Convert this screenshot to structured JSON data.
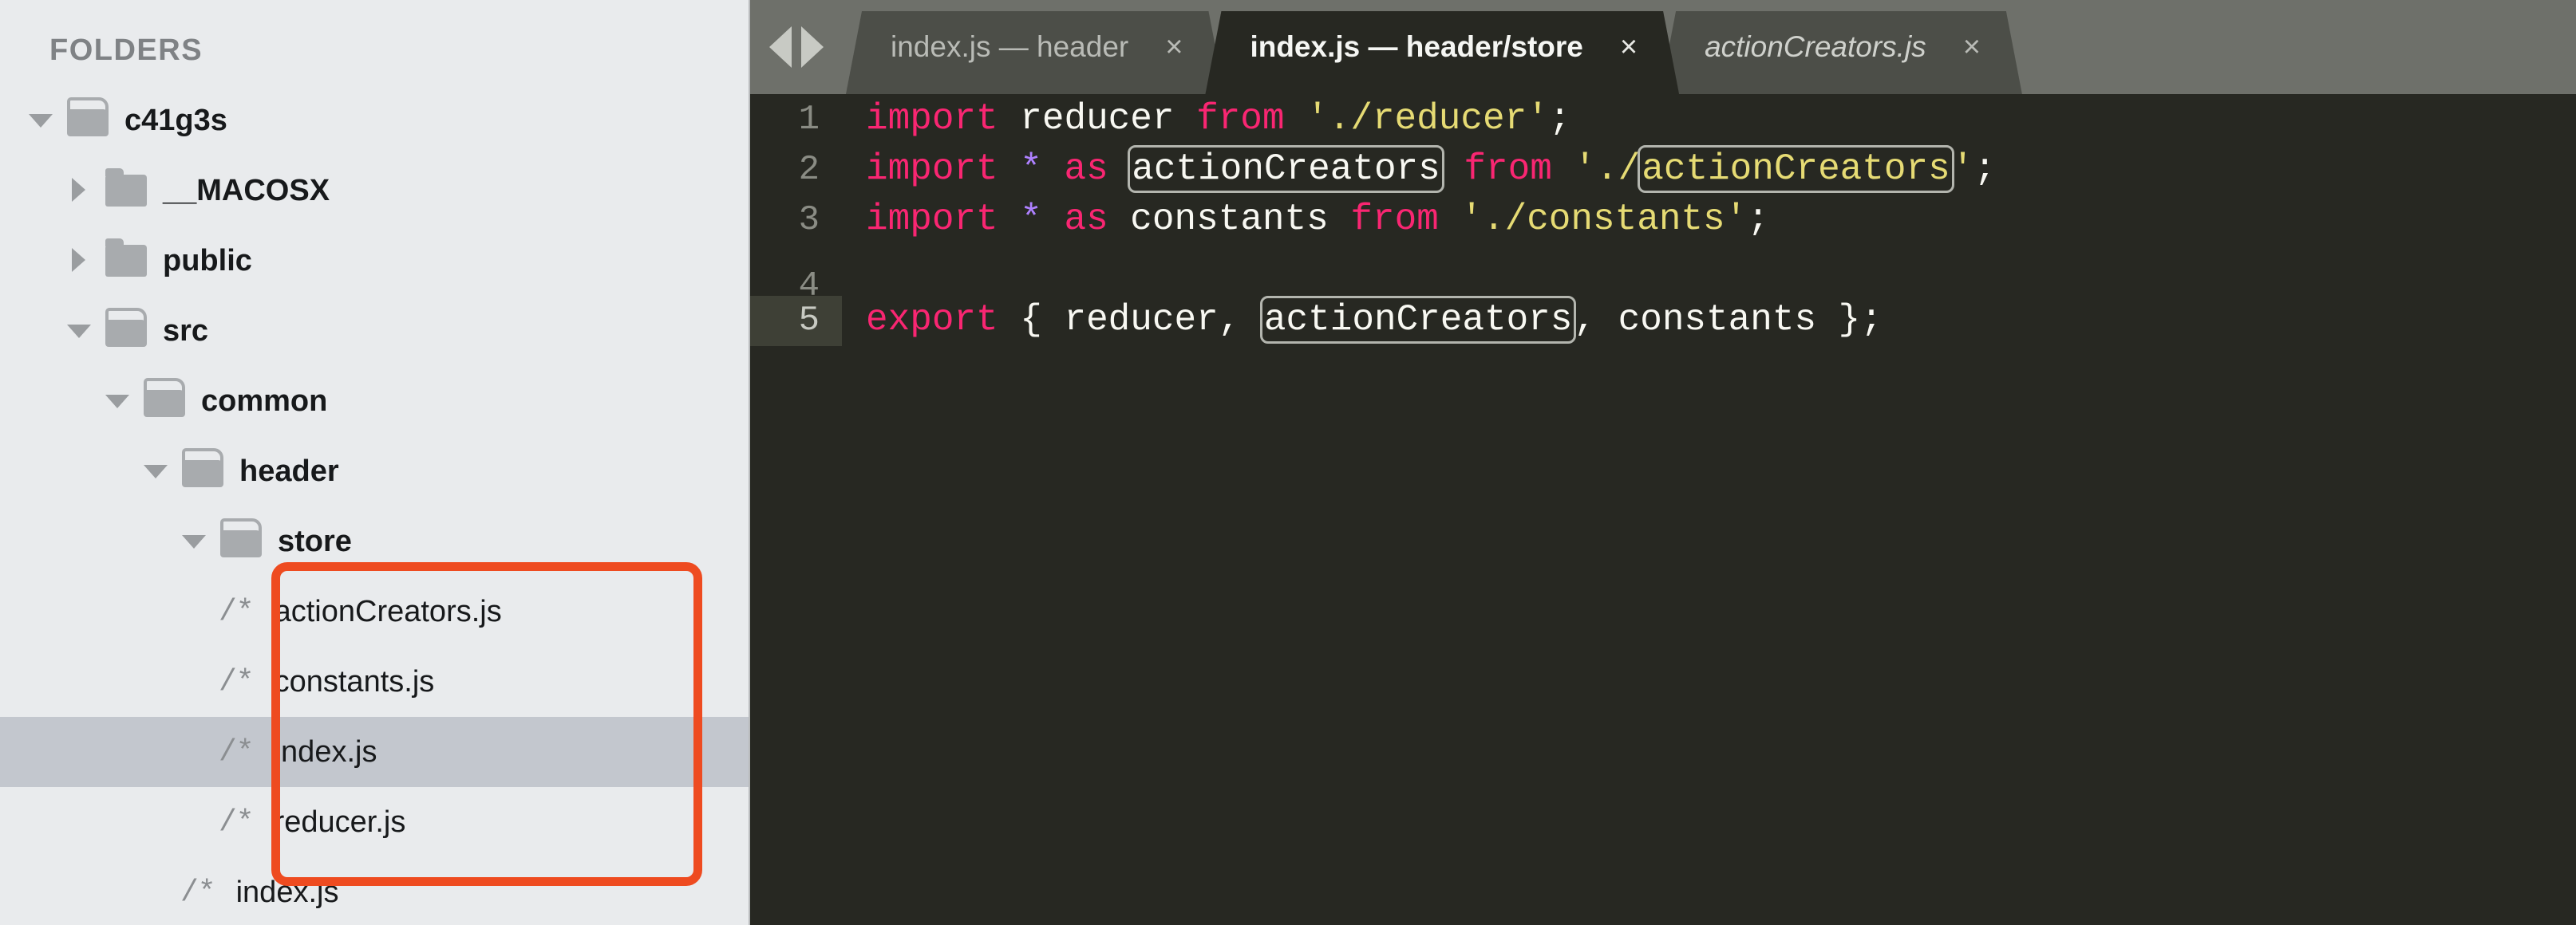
{
  "sidebar": {
    "header": "FOLDERS",
    "tree": [
      {
        "label": "c41g3s",
        "type": "folder",
        "state": "open",
        "depth": 0,
        "selected": false
      },
      {
        "label": "__MACOSX",
        "type": "folder",
        "state": "closed",
        "depth": 1,
        "selected": false
      },
      {
        "label": "public",
        "type": "folder",
        "state": "closed",
        "depth": 1,
        "selected": false
      },
      {
        "label": "src",
        "type": "folder",
        "state": "open",
        "depth": 1,
        "selected": false
      },
      {
        "label": "common",
        "type": "folder",
        "state": "open",
        "depth": 2,
        "selected": false
      },
      {
        "label": "header",
        "type": "folder",
        "state": "open",
        "depth": 3,
        "selected": false
      },
      {
        "label": "store",
        "type": "folder",
        "state": "open",
        "depth": 4,
        "selected": false
      },
      {
        "label": "actionCreators.js",
        "type": "file",
        "icon": "/*",
        "depth": 5,
        "selected": false
      },
      {
        "label": "constants.js",
        "type": "file",
        "icon": "/*",
        "depth": 5,
        "selected": false
      },
      {
        "label": "index.js",
        "type": "file",
        "icon": "/*",
        "depth": 5,
        "selected": true
      },
      {
        "label": "reducer.js",
        "type": "file",
        "icon": "/*",
        "depth": 5,
        "selected": false
      },
      {
        "label": "index.js",
        "type": "file",
        "icon": "/*",
        "depth": 4,
        "selected": false
      }
    ],
    "annotation": {
      "color": "#ee4b20",
      "covers": [
        "actionCreators.js",
        "constants.js",
        "index.js",
        "reducer.js"
      ]
    }
  },
  "editor": {
    "nav": {
      "prev_icon": "left-arrow-icon",
      "next_icon": "right-arrow-icon"
    },
    "tabs": [
      {
        "label": "index.js — header",
        "close": "×",
        "active": false,
        "preview": false
      },
      {
        "label": "index.js — header/store",
        "close": "×",
        "active": true,
        "preview": false
      },
      {
        "label": "actionCreators.js",
        "close": "×",
        "active": false,
        "preview": true
      }
    ],
    "code": {
      "lines": [
        {
          "number": "1",
          "current": false,
          "tokens": [
            {
              "t": "import",
              "c": "kw"
            },
            {
              "t": " ",
              "c": "punc"
            },
            {
              "t": "reducer",
              "c": "id"
            },
            {
              "t": " ",
              "c": "punc"
            },
            {
              "t": "from",
              "c": "kw"
            },
            {
              "t": " ",
              "c": "punc"
            },
            {
              "t": "'./reducer'",
              "c": "str"
            },
            {
              "t": ";",
              "c": "punc"
            }
          ]
        },
        {
          "number": "2",
          "current": false,
          "tokens": [
            {
              "t": "import",
              "c": "kw"
            },
            {
              "t": " ",
              "c": "punc"
            },
            {
              "t": "*",
              "c": "op"
            },
            {
              "t": " ",
              "c": "punc"
            },
            {
              "t": "as",
              "c": "kw"
            },
            {
              "t": " ",
              "c": "punc"
            },
            {
              "t": "actionCreators",
              "c": "id",
              "hit": true
            },
            {
              "t": " ",
              "c": "punc"
            },
            {
              "t": "from",
              "c": "kw"
            },
            {
              "t": " ",
              "c": "punc"
            },
            {
              "t": "'./",
              "c": "str"
            },
            {
              "t": "actionCreators",
              "c": "str",
              "hit": true
            },
            {
              "t": "'",
              "c": "str"
            },
            {
              "t": ";",
              "c": "punc"
            }
          ]
        },
        {
          "number": "3",
          "current": false,
          "tokens": [
            {
              "t": "import",
              "c": "kw"
            },
            {
              "t": " ",
              "c": "punc"
            },
            {
              "t": "*",
              "c": "op"
            },
            {
              "t": " ",
              "c": "punc"
            },
            {
              "t": "as",
              "c": "kw"
            },
            {
              "t": " ",
              "c": "punc"
            },
            {
              "t": "constants",
              "c": "id"
            },
            {
              "t": " ",
              "c": "punc"
            },
            {
              "t": "from",
              "c": "kw"
            },
            {
              "t": " ",
              "c": "punc"
            },
            {
              "t": "'./constants'",
              "c": "str"
            },
            {
              "t": ";",
              "c": "punc"
            }
          ]
        },
        {
          "number": "4",
          "current": false,
          "tokens": []
        },
        {
          "number": "5",
          "current": true,
          "tokens": [
            {
              "t": "export",
              "c": "kw"
            },
            {
              "t": " { ",
              "c": "punc"
            },
            {
              "t": "reducer",
              "c": "id"
            },
            {
              "t": ", ",
              "c": "punc"
            },
            {
              "t": "actionCreators",
              "c": "id",
              "hit": true
            },
            {
              "t": ", ",
              "c": "punc"
            },
            {
              "t": "constants",
              "c": "id"
            },
            {
              "t": " };",
              "c": "punc"
            }
          ]
        }
      ]
    }
  },
  "colors": {
    "sidebar_bg": "#e9ebed",
    "sidebar_selected": "#c3c7ce",
    "editor_bg": "#272822",
    "tabbar_bg": "#6e706a",
    "tab_inactive": "#4c4e48",
    "annotation": "#ee4b20",
    "keyword": "#f92672",
    "string": "#e6db74",
    "operator": "#ae81ff",
    "identifier": "#f8f8f2"
  }
}
